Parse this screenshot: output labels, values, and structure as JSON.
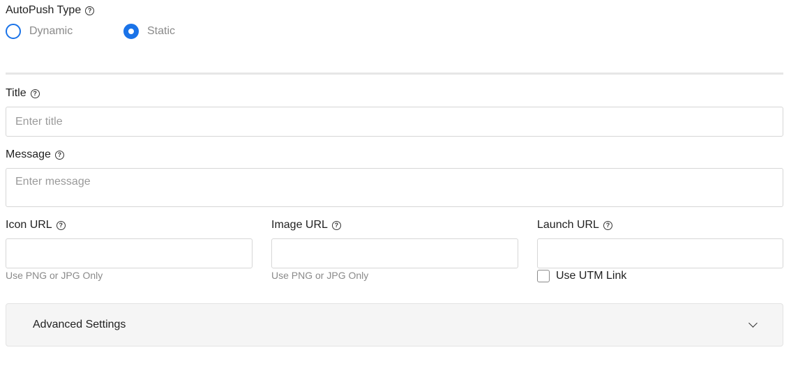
{
  "autopush": {
    "label": "AutoPush Type",
    "options": [
      {
        "label": "Dynamic",
        "checked": false
      },
      {
        "label": "Static",
        "checked": true
      }
    ]
  },
  "title": {
    "label": "Title",
    "placeholder": "Enter title"
  },
  "message": {
    "label": "Message",
    "placeholder": "Enter message"
  },
  "icon_url": {
    "label": "Icon URL",
    "hint": "Use PNG or JPG Only"
  },
  "image_url": {
    "label": "Image URL",
    "hint": "Use PNG or JPG Only"
  },
  "launch_url": {
    "label": "Launch URL",
    "utm_label": "Use UTM Link",
    "utm_checked": false
  },
  "advanced": {
    "label": "Advanced Settings"
  },
  "colors": {
    "accent": "#1a73e8",
    "muted_text": "#8a8a8a",
    "border": "#d6d6d6"
  },
  "icons": {
    "help": "question-circle-icon",
    "chevron": "chevron-down-icon"
  }
}
